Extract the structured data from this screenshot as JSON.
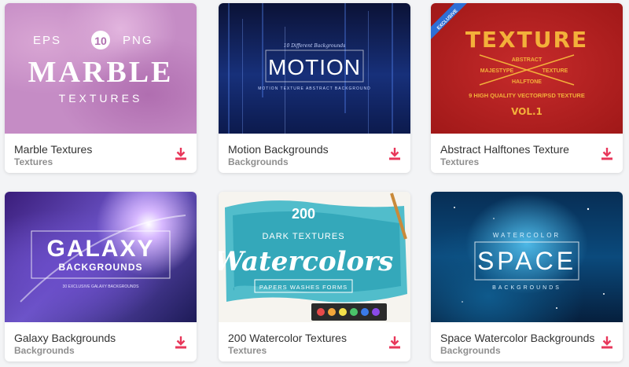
{
  "colors": {
    "accent": "#e8375a",
    "title_text": "#333333",
    "category_text": "#8f8f8f",
    "background": "#f3f4f6"
  },
  "cards": [
    {
      "title": "Marble Textures",
      "category": "Textures",
      "thumb": {
        "top_line_left": "EPS",
        "badge": "10",
        "top_line_right": "PNG",
        "main": "MARBLE",
        "sub": "TEXTURES"
      }
    },
    {
      "title": "Motion Backgrounds",
      "category": "Backgrounds",
      "thumb": {
        "kicker": "10 Different Backgrounds",
        "main": "MOTION",
        "sub": "MOTION TEXTURE ABSTRACT BACKGROUND"
      }
    },
    {
      "title": "Abstract Halftones Texture",
      "category": "Textures",
      "thumb": {
        "ribbon": "EXCLUSIVE",
        "main": "TEXTURE",
        "abstract": "ABSTRACT",
        "majestype": "MAJESTYPE",
        "texture": "TEXTURE",
        "halftone": "HALFTONE",
        "line": "9 HIGH QUALITY VECTOR/PSD TEXTURE",
        "vol": "VOL.1"
      }
    },
    {
      "title": "Galaxy Backgrounds",
      "category": "Backgrounds",
      "thumb": {
        "main": "GALAXY",
        "sub": "BACKGROUNDS",
        "kicker": "30 EXCLUSIVE GALAXY BACKGROUNDS"
      }
    },
    {
      "title": "200 Watercolor Textures",
      "category": "Textures",
      "thumb": {
        "count": "200",
        "line1": "DARK TEXTURES",
        "main": "Watercolors",
        "tags": "PAPERS  WASHES  FORMS"
      }
    },
    {
      "title": "Space Watercolor Backgrounds",
      "category": "Backgrounds",
      "thumb": {
        "kicker": "WATERCOLOR",
        "main": "SPACE",
        "sub": "BACKGROUNDS"
      }
    }
  ]
}
